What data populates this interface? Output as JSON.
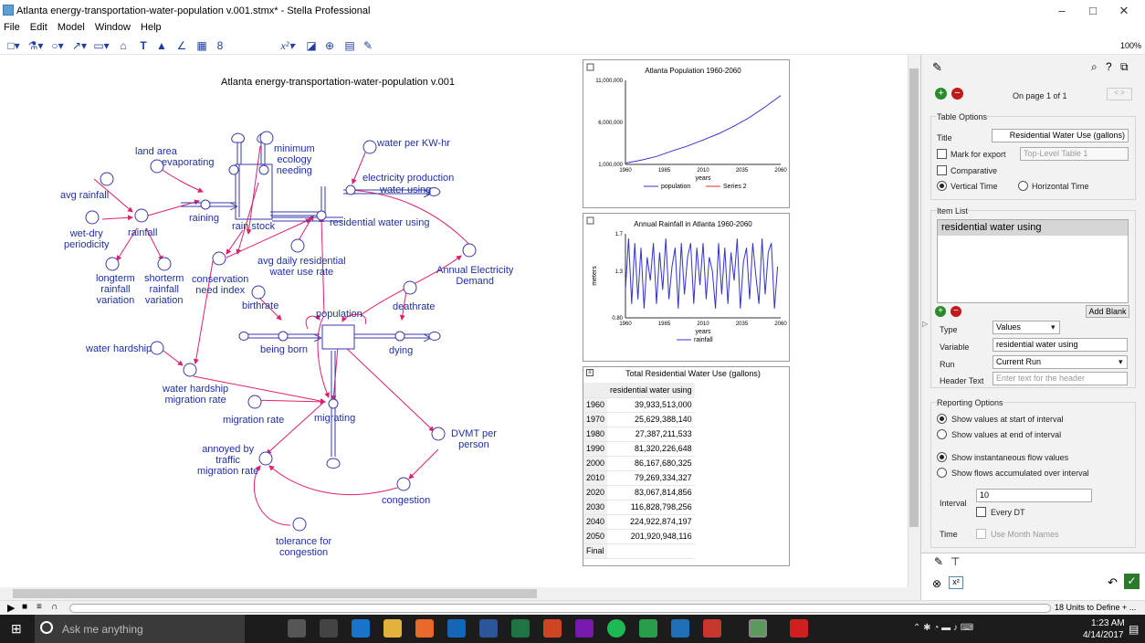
{
  "window": {
    "title": "Atlanta energy-transportation-water-population v.001.stmx* - Stella Professional",
    "minimize": "–",
    "maximize": "□",
    "close": "✕"
  },
  "menu": [
    "File",
    "Edit",
    "Model",
    "Window",
    "Help"
  ],
  "toolbar": {
    "zoom": "100%",
    "tools": [
      "□▾",
      "⚗▾",
      "○▾",
      "↗▾",
      "▭▾",
      "⌂",
      "T",
      "▲",
      "∠",
      "▦",
      "8",
      "x²▾",
      "◪",
      "⊕",
      "▤",
      "✎"
    ]
  },
  "model": {
    "title": "Atlanta energy-transportation-water-population v.001",
    "labels": {
      "land_area": "land area",
      "evaporating": "evaporating",
      "minimum_ecology": "minimum\necology\nneeding",
      "water_per_kw": "water per KW-hr",
      "electricity_production": "electricity production",
      "water_using": "water using",
      "avg_rainfall": "avg rainfall",
      "raining": "raining",
      "rain_stock": "rain stock",
      "residential_water_using": "residential water using",
      "wet_dry": "wet-dry\nperiodicity",
      "rainfall": "rainfall",
      "longterm": "longterm\nrainfall\nvariation",
      "shorterm": "shorterm\nrainfall\nvariation",
      "conservation": "conservation\nneed index",
      "avg_daily": "avg daily residential\nwater use rate",
      "annual_elec": "Annual Electricity\nDemand",
      "birthrate": "birthrate",
      "population": "population",
      "deathrate": "deathrate",
      "being_born": "being born",
      "dying": "dying",
      "water_hardship": "water hardship",
      "wh_migration": "water hardship\nmigration rate",
      "migration_rate": "migration rate",
      "migrating": "migrating",
      "dvmt": "DVMT per\nperson",
      "annoyed": "annoyed by\ntraffic\nmigration rate",
      "congestion": "congestion",
      "tolerance": "tolerance for\ncongestion"
    }
  },
  "graph1": {
    "chart_data": {
      "type": "line",
      "title": "Atlanta Population 1960-2060",
      "xlabel": "years",
      "ylabel": "",
      "x_ticks": [
        "1960",
        "1985",
        "2010",
        "2035",
        "2060"
      ],
      "y_ticks": [
        "1,000,000",
        "6,000,000",
        "11,000,000"
      ],
      "xlim": [
        1960,
        2060
      ],
      "ylim": [
        1000000,
        11000000
      ],
      "legend": [
        "population",
        "Series 2"
      ],
      "series": [
        {
          "name": "population",
          "color": "#3333cc",
          "x": [
            1960,
            1970,
            1980,
            1990,
            2000,
            2010,
            2020,
            2030,
            2040,
            2050,
            2060
          ],
          "values": [
            1150000,
            1500000,
            1950000,
            2600000,
            3200000,
            3900000,
            4650000,
            5550000,
            6600000,
            7850000,
            9200000
          ]
        }
      ]
    }
  },
  "graph2": {
    "chart_data": {
      "type": "line",
      "title": "Annual Rainfall in Atlanta 1960-2060",
      "xlabel": "years",
      "ylabel": "meters",
      "x_ticks": [
        "1960",
        "1985",
        "2010",
        "2035",
        "2060"
      ],
      "y_ticks": [
        "0.80",
        "1.3",
        "1.7"
      ],
      "xlim": [
        1960,
        2060
      ],
      "ylim": [
        0.8,
        1.7
      ],
      "legend": [
        "rainfall"
      ],
      "series": [
        {
          "name": "rainfall",
          "color": "#3333cc",
          "x": [
            1960,
            1962,
            1964,
            1966,
            1968,
            1970,
            1972,
            1974,
            1976,
            1978,
            1980,
            1982,
            1984,
            1986,
            1988,
            1990,
            1992,
            1994,
            1996,
            1998,
            2000,
            2002,
            2004,
            2006,
            2008,
            2010,
            2012,
            2014,
            2016,
            2018,
            2020,
            2022,
            2024,
            2026,
            2028,
            2030,
            2032,
            2034,
            2036,
            2038,
            2040,
            2042,
            2044,
            2046,
            2048,
            2050,
            2052,
            2054,
            2056,
            2058
          ],
          "values": [
            1.1,
            1.65,
            0.95,
            1.6,
            1.0,
            1.55,
            0.9,
            1.45,
            1.2,
            1.6,
            0.95,
            1.5,
            1.1,
            1.65,
            1.0,
            1.35,
            1.55,
            0.9,
            1.6,
            1.05,
            1.45,
            1.6,
            0.95,
            1.55,
            1.15,
            1.6,
            1.0,
            1.45,
            1.3,
            0.9,
            1.6,
            1.05,
            1.55,
            0.95,
            1.5,
            1.2,
            1.65,
            0.9,
            1.4,
            1.55,
            1.0,
            1.6,
            1.25,
            0.95,
            1.65,
            1.05,
            1.5,
            1.6,
            0.9,
            1.35
          ]
        }
      ]
    }
  },
  "table": {
    "title": "Total Residential Water Use (gallons)",
    "column": "residential water using",
    "rows": [
      {
        "year": "1960",
        "value": "39,933,513,000"
      },
      {
        "year": "1970",
        "value": "25,629,388,140"
      },
      {
        "year": "1980",
        "value": "27,387,211,533"
      },
      {
        "year": "1990",
        "value": "81,320,226,648"
      },
      {
        "year": "2000",
        "value": "86,167,680,325"
      },
      {
        "year": "2010",
        "value": "79,269,334,327"
      },
      {
        "year": "2020",
        "value": "83,067,814,856"
      },
      {
        "year": "2030",
        "value": "116,828,798,256"
      },
      {
        "year": "2040",
        "value": "224,922,874,197"
      },
      {
        "year": "2050",
        "value": "201,920,948,116"
      },
      {
        "year": "Final",
        "value": ""
      }
    ]
  },
  "props": {
    "page": "On page 1 of 1",
    "table_options": "Table Options",
    "title_label": "Title",
    "title_value": "Residential Water Use (gallons)",
    "mark_export": "Mark for export",
    "export_placeholder": "Top-Level Table 1",
    "comparative": "Comparative",
    "vertical": "Vertical Time",
    "horizontal": "Horizontal Time",
    "item_list": "Item List",
    "item": "residential water using",
    "add_blank": "Add Blank",
    "type_label": "Type",
    "type_value": "Values",
    "variable_label": "Variable",
    "variable_value": "residential water using",
    "run_label": "Run",
    "run_value": "Current Run",
    "header_label": "Header Text",
    "header_placeholder": "Enter text for the header",
    "reporting": "Reporting Options",
    "start": "Show values at start of interval",
    "end": "Show values at end of interval",
    "instant": "Show instantaneous flow values",
    "accum": "Show flows accumulated over interval",
    "interval_label": "Interval",
    "interval_value": "10",
    "every_dt": "Every DT",
    "time_label": "Time",
    "month_names": "Use Month Names"
  },
  "runbar": {
    "units": "18 Units to Define + ..."
  },
  "taskbar": {
    "search": "Ask me anything",
    "time": "1:23 AM",
    "date": "4/14/2017"
  },
  "colors": {
    "model_text": "#1f2fa8",
    "connector": "#e0206e",
    "accent": "#2a7a2a"
  }
}
